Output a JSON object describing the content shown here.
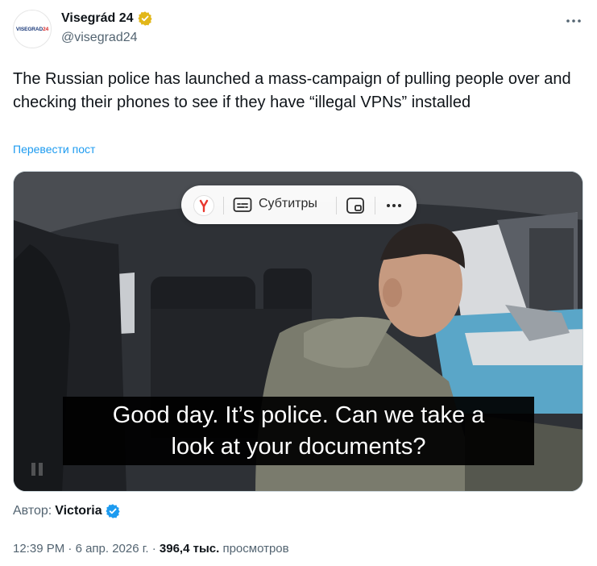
{
  "author": {
    "display_name": "Visegrád 24",
    "handle": "@visegrad24",
    "avatar_text_main": "VISEGRAD",
    "avatar_text_accent": "24",
    "verified_badge": "gold-check-badge"
  },
  "tweet": {
    "text": "The Russian police has launched a mass-campaign of pulling people over and checking their phones to see if they have “illegal VPNs” installed",
    "translate_label": "Перевести пост"
  },
  "video": {
    "toolbar": {
      "subtitles_label": "Субтитры"
    },
    "subtitle_line1": "Good day. It’s police. Can we take a",
    "subtitle_line2": "look at your documents?"
  },
  "credit": {
    "label": "Автор:",
    "name": "Victoria",
    "verified_badge": "blue-check-badge"
  },
  "meta": {
    "time": "12:39 PM",
    "separator1": " · ",
    "date": "6 апр. 2026 г.",
    "separator2": " · ",
    "views_count": "396,4 тыс.",
    "views_label": " просмотров"
  },
  "colors": {
    "link_blue": "#1d9bf0",
    "gold_badge": "#e2b719",
    "blue_badge": "#1d9bf0"
  }
}
